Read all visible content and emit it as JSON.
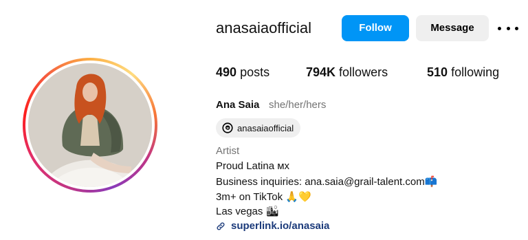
{
  "profile": {
    "username": "anasaiaofficial",
    "follow_label": "Follow",
    "message_label": "Message",
    "stats": {
      "posts_count": "490",
      "posts_label": "posts",
      "followers_count": "794K",
      "followers_label": "followers",
      "following_count": "510",
      "following_label": "following"
    },
    "name": "Ana Saia",
    "pronouns": "she/her/hers",
    "threads_handle": "anasaiaofficial",
    "category": "Artist",
    "bio_lines": [
      "Proud Latina ᴍx",
      "Business inquiries: ana.saia@grail-talent.com",
      "3m+ on TikTok",
      "Las vegas"
    ],
    "link": "superlink.io/anasaia"
  },
  "icons": {
    "more": "more-options-icon",
    "threads": "threads-icon",
    "link": "link-icon",
    "mailbox": "mailbox-emoji",
    "pray": "folded-hands-emoji",
    "heart": "yellow-heart-emoji",
    "city": "cityscape-emoji"
  },
  "colors": {
    "follow_button": "#0095f6",
    "message_button": "#efefef",
    "secondary_text": "#737373",
    "link_text": "#1b3a7a"
  }
}
